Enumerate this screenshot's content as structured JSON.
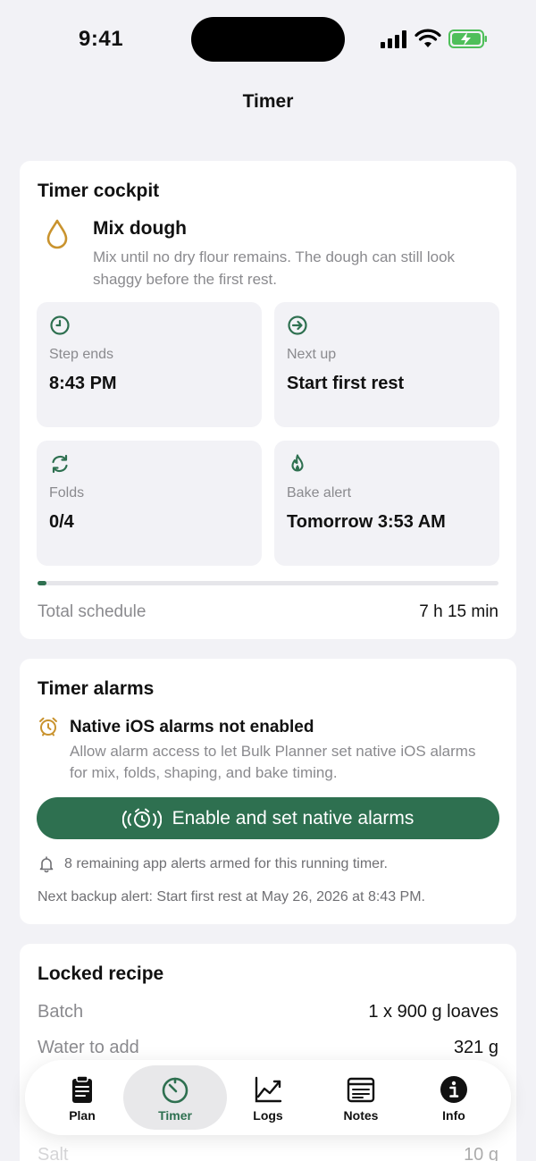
{
  "status_bar": {
    "time": "9:41"
  },
  "nav": {
    "title": "Timer"
  },
  "timer_cockpit": {
    "title": "Timer cockpit",
    "step_name": "Mix dough",
    "step_description": "Mix until no dry flour remains. The dough can still look shaggy before the first rest.",
    "tiles": [
      {
        "icon": "clock-icon",
        "label": "Step ends",
        "value": "8:43 PM"
      },
      {
        "icon": "arrow-right-circle-icon",
        "label": "Next up",
        "value": "Start first rest"
      },
      {
        "icon": "refresh-icon",
        "label": "Folds",
        "value": "0/4"
      },
      {
        "icon": "flame-icon",
        "label": "Bake alert",
        "value": "Tomorrow 3:53 AM"
      }
    ],
    "progress_fraction": 0.02,
    "total_label": "Total schedule",
    "total_value": "7 h 15 min"
  },
  "timer_alarms": {
    "title": "Timer alarms",
    "alarm_title": "Native iOS alarms not enabled",
    "alarm_description": "Allow alarm access to let Bulk Planner set native iOS alarms for mix, folds, shaping, and bake timing.",
    "enable_button": "Enable and set native alarms",
    "alerts_armed": "8 remaining app alerts armed for this running timer.",
    "next_backup": "Next backup alert: Start first rest at May 26, 2026 at 8:43 PM."
  },
  "locked_recipe": {
    "title": "Locked recipe",
    "rows": [
      {
        "key": "Batch",
        "value": "1 x 900 g loaves"
      },
      {
        "key": "Water to add",
        "value": "321 g"
      },
      {
        "key": "Salt",
        "value": "10 g"
      }
    ]
  },
  "tab_bar": {
    "tabs": [
      {
        "label": "Plan",
        "icon": "clipboard-icon"
      },
      {
        "label": "Timer",
        "icon": "timer-icon"
      },
      {
        "label": "Logs",
        "icon": "chart-icon"
      },
      {
        "label": "Notes",
        "icon": "notes-icon"
      },
      {
        "label": "Info",
        "icon": "info-icon"
      }
    ],
    "active": "Timer"
  },
  "colors": {
    "accent": "#2e7050",
    "warning": "#c9932e",
    "background": "#f2f2f6"
  }
}
